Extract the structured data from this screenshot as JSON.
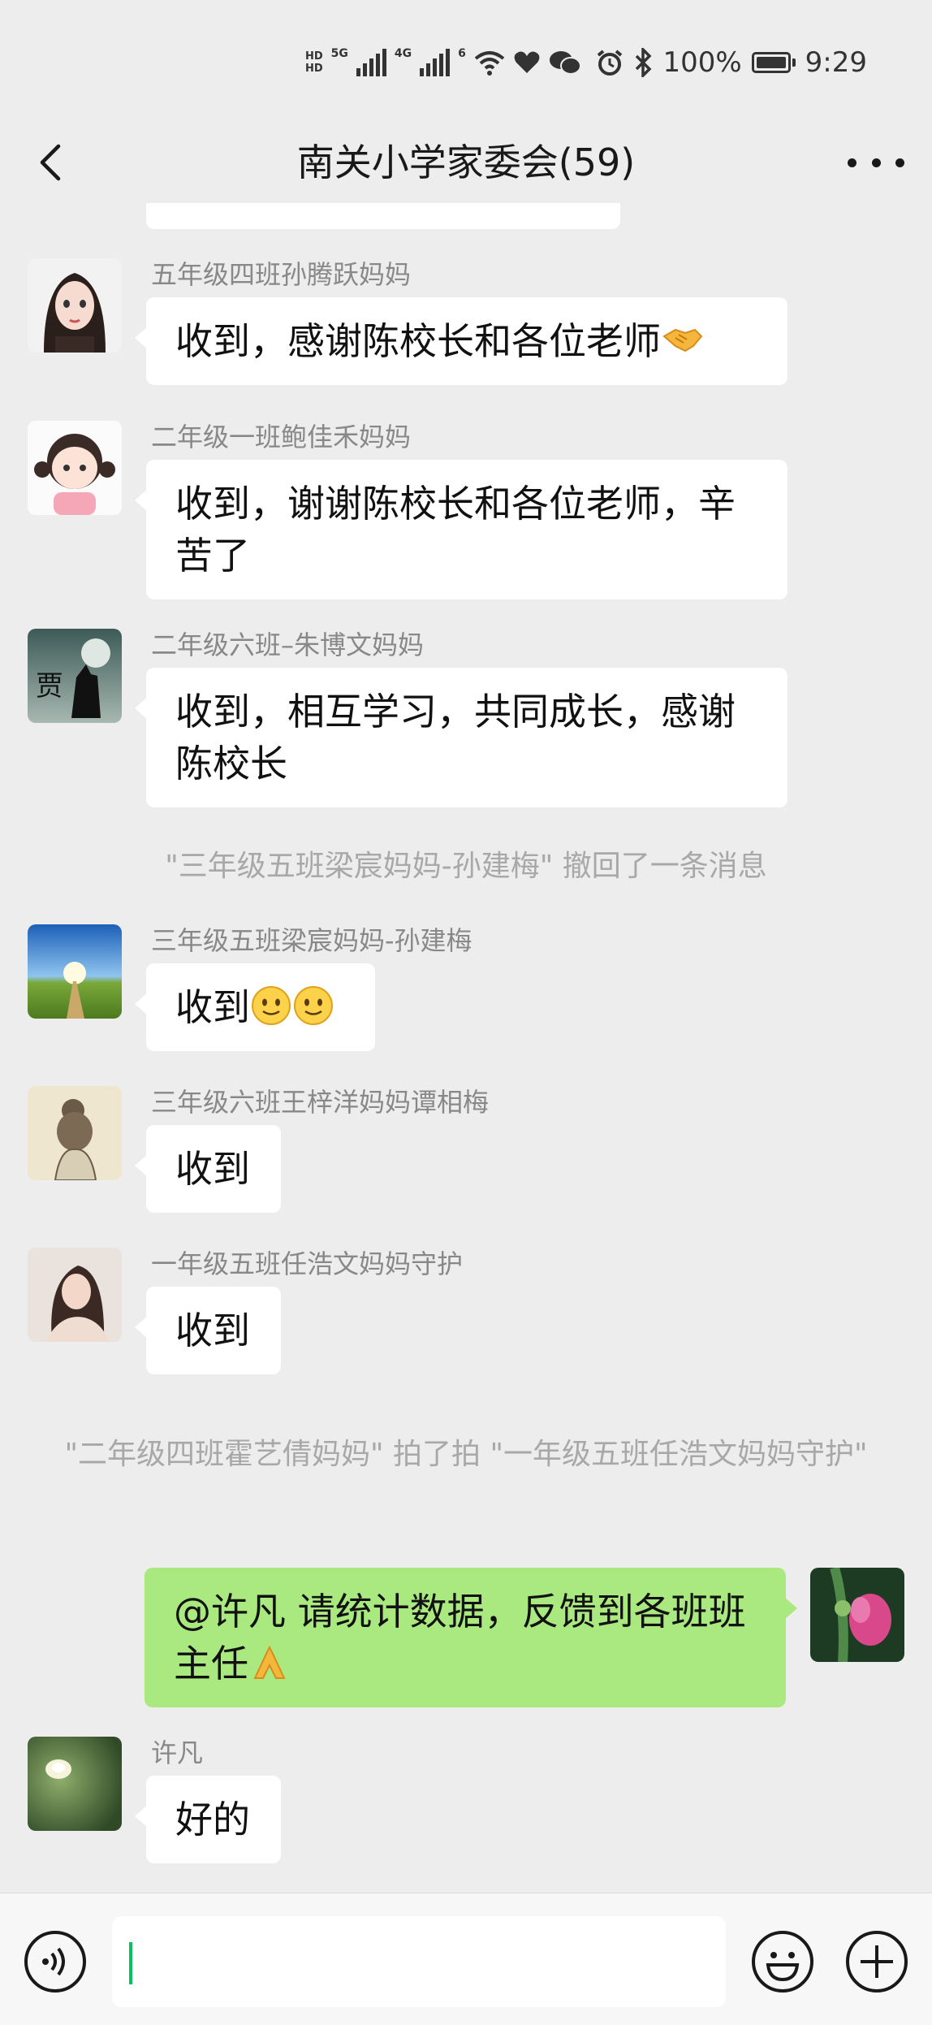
{
  "status_bar": {
    "net_hd1": "HD",
    "net_hd2": "HD",
    "net_5g": "5G",
    "net_4g": "4G",
    "net_6": "6",
    "battery": "100%",
    "time": "9:29",
    "icons": [
      "signal-icon",
      "wifi-icon",
      "heart-icon",
      "wechat-icon",
      "alarm-icon",
      "bluetooth-icon",
      "battery-icon"
    ]
  },
  "header": {
    "title": "南关小学家委会(59)",
    "back_icon": "chevron-left-icon",
    "more_icon": "more-icon"
  },
  "messages": [
    {
      "sender": "五年级四班孙腾跃妈妈",
      "text": "收到，感谢陈校长和各位老师",
      "emoji": "handshake"
    },
    {
      "sender": "二年级一班鲍佳禾妈妈",
      "text": "收到，谢谢陈校长和各位老师，辛苦了"
    },
    {
      "sender": "二年级六班–朱博文妈妈",
      "text": "收到，相互学习，共同成长，感谢陈校长",
      "avatar_text": "贾"
    },
    {
      "sender": "三年级五班梁宸妈妈-孙建梅",
      "text": "收到",
      "emoji": "smile x2"
    },
    {
      "sender": "三年级六班王梓洋妈妈谭相梅",
      "text": "收到"
    },
    {
      "sender": "一年级五班任浩文妈妈守护",
      "text": "收到"
    },
    {
      "sender": "许凡",
      "text": "好的"
    }
  ],
  "system_messages": {
    "recall": "\"三年级五班梁宸妈妈-孙建梅\" 撤回了一条消息",
    "pat": "\"二年级四班霍艺倩妈妈\" 拍了拍 \"一年级五班任浩文妈妈守护\""
  },
  "my_message": {
    "text": "@许凡  请统计数据，反馈到各班班主任",
    "emoji": "pray"
  },
  "input_bar": {
    "value": "",
    "icons": [
      "voice-icon",
      "emoji-icon",
      "plus-icon"
    ]
  },
  "colors": {
    "background": "#ededed",
    "bubble_other": "#ffffff",
    "bubble_mine": "#a9e97f",
    "sender_text": "#888888",
    "system_text": "#a8a8a8",
    "cursor": "#07c160"
  }
}
